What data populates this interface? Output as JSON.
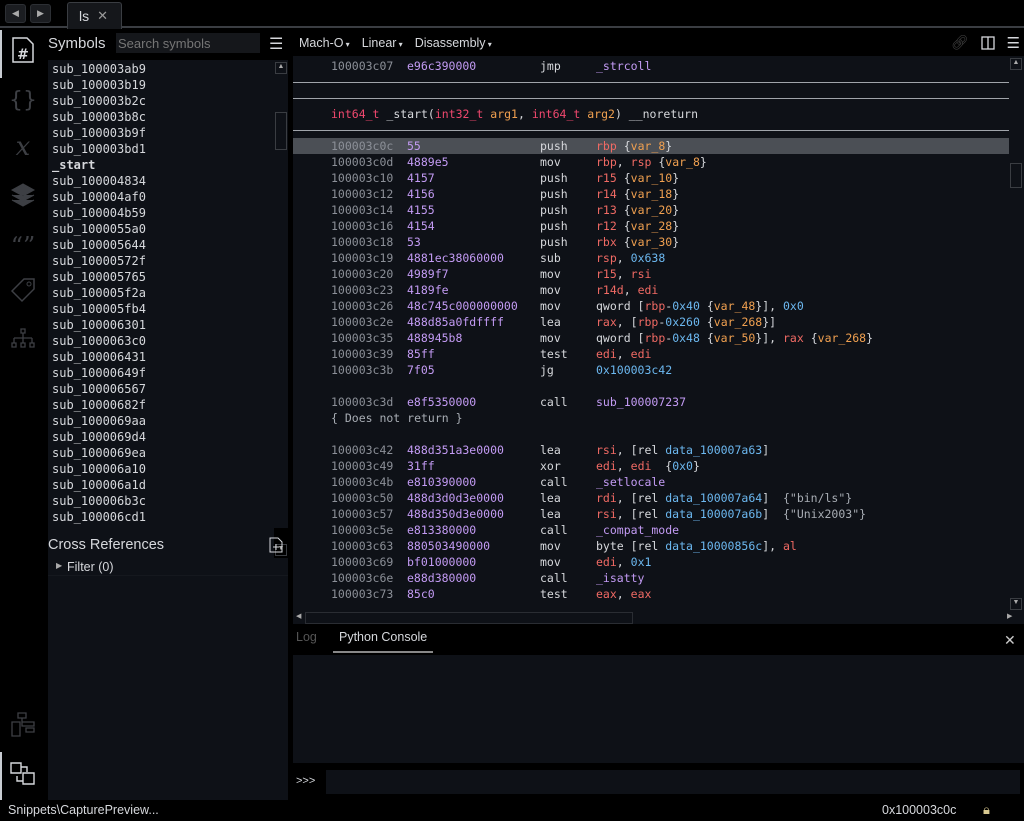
{
  "tabs": {
    "back": "◀",
    "forward": "▶",
    "document": "ls",
    "close": "✕"
  },
  "sidebar_icons": [
    "symbols-icon",
    "types-icon",
    "variables-icon",
    "stack-icon",
    "strings-icon",
    "tags-icon",
    "hierarchy-icon"
  ],
  "symbols": {
    "title": "Symbols",
    "search_placeholder": "Search symbols",
    "items": [
      "sub_100003ab9",
      "sub_100003b19",
      "sub_100003b2c",
      "sub_100003b8c",
      "sub_100003b9f",
      "sub_100003bd1",
      "_start",
      "sub_100004834",
      "sub_100004af0",
      "sub_100004b59",
      "sub_1000055a0",
      "sub_100005644",
      "sub_10000572f",
      "sub_100005765",
      "sub_100005f2a",
      "sub_100005fb4",
      "sub_100006301",
      "sub_1000063c0",
      "sub_100006431",
      "sub_10000649f",
      "sub_100006567",
      "sub_10000682f",
      "sub_1000069aa",
      "sub_1000069d4",
      "sub_1000069ea",
      "sub_100006a10",
      "sub_100006a1d",
      "sub_100006b3c",
      "sub_100006cd1"
    ],
    "selected": "_start"
  },
  "xref": {
    "title": "Cross References",
    "filter": "Filter (0)"
  },
  "toolbar": {
    "view_type": "Mach-O",
    "layout": "Linear",
    "mode": "Disassembly"
  },
  "disassembly": {
    "pre": {
      "addr": "100003c07",
      "bytes": "e96c390000",
      "mn": "jmp",
      "ops": [
        [
          "_strcoll",
          "s"
        ]
      ]
    },
    "func_header": [
      [
        "int64_t",
        "t"
      ],
      [
        " _start(",
        "p"
      ],
      [
        "int32_t",
        "t"
      ],
      [
        " ",
        "p"
      ],
      [
        "arg1",
        "a"
      ],
      [
        ", ",
        "p"
      ],
      [
        "int64_t",
        "t"
      ],
      [
        " ",
        "p"
      ],
      [
        "arg2",
        "a"
      ],
      [
        ") __noreturn",
        "p"
      ]
    ],
    "lines": [
      {
        "addr": "100003c0c",
        "bytes": "55",
        "mn": "push",
        "ops": [
          [
            "rbp",
            "r"
          ],
          [
            " {",
            "p"
          ],
          [
            "var_8",
            "v"
          ],
          [
            "}",
            "p"
          ]
        ],
        "hl": true
      },
      {
        "addr": "100003c0d",
        "bytes": "4889e5",
        "mn": "mov",
        "ops": [
          [
            "rbp",
            "r"
          ],
          [
            ", ",
            "p"
          ],
          [
            "rsp",
            "r"
          ],
          [
            " {",
            "p"
          ],
          [
            "var_8",
            "v"
          ],
          [
            "}",
            "p"
          ]
        ]
      },
      {
        "addr": "100003c10",
        "bytes": "4157",
        "mn": "push",
        "ops": [
          [
            "r15",
            "r"
          ],
          [
            " {",
            "p"
          ],
          [
            "var_10",
            "v"
          ],
          [
            "}",
            "p"
          ]
        ]
      },
      {
        "addr": "100003c12",
        "bytes": "4156",
        "mn": "push",
        "ops": [
          [
            "r14",
            "r"
          ],
          [
            " {",
            "p"
          ],
          [
            "var_18",
            "v"
          ],
          [
            "}",
            "p"
          ]
        ]
      },
      {
        "addr": "100003c14",
        "bytes": "4155",
        "mn": "push",
        "ops": [
          [
            "r13",
            "r"
          ],
          [
            " {",
            "p"
          ],
          [
            "var_20",
            "v"
          ],
          [
            "}",
            "p"
          ]
        ]
      },
      {
        "addr": "100003c16",
        "bytes": "4154",
        "mn": "push",
        "ops": [
          [
            "r12",
            "r"
          ],
          [
            " {",
            "p"
          ],
          [
            "var_28",
            "v"
          ],
          [
            "}",
            "p"
          ]
        ]
      },
      {
        "addr": "100003c18",
        "bytes": "53",
        "mn": "push",
        "ops": [
          [
            "rbx",
            "r"
          ],
          [
            " {",
            "p"
          ],
          [
            "var_30",
            "v"
          ],
          [
            "}",
            "p"
          ]
        ]
      },
      {
        "addr": "100003c19",
        "bytes": "4881ec38060000",
        "mn": "sub",
        "ops": [
          [
            "rsp",
            "r"
          ],
          [
            ", ",
            "p"
          ],
          [
            "0x638",
            "n"
          ]
        ]
      },
      {
        "addr": "100003c20",
        "bytes": "4989f7",
        "mn": "mov",
        "ops": [
          [
            "r15",
            "r"
          ],
          [
            ", ",
            "p"
          ],
          [
            "rsi",
            "r"
          ]
        ]
      },
      {
        "addr": "100003c23",
        "bytes": "4189fe",
        "mn": "mov",
        "ops": [
          [
            "r14d",
            "r"
          ],
          [
            ", ",
            "p"
          ],
          [
            "edi",
            "r"
          ]
        ]
      },
      {
        "addr": "100003c26",
        "bytes": "48c745c000000000",
        "mn": "mov",
        "ops": [
          [
            "qword [",
            "p"
          ],
          [
            "rbp",
            "r"
          ],
          [
            "-",
            "p"
          ],
          [
            "0x40",
            "n"
          ],
          [
            " {",
            "p"
          ],
          [
            "var_48",
            "v"
          ],
          [
            "}], ",
            "p"
          ],
          [
            "0x0",
            "n"
          ]
        ]
      },
      {
        "addr": "100003c2e",
        "bytes": "488d85a0fdffff",
        "mn": "lea",
        "ops": [
          [
            "rax",
            "r"
          ],
          [
            ", [",
            "p"
          ],
          [
            "rbp",
            "r"
          ],
          [
            "-",
            "p"
          ],
          [
            "0x260",
            "n"
          ],
          [
            " {",
            "p"
          ],
          [
            "var_268",
            "v"
          ],
          [
            "}]",
            "p"
          ]
        ]
      },
      {
        "addr": "100003c35",
        "bytes": "488945b8",
        "mn": "mov",
        "ops": [
          [
            "qword [",
            "p"
          ],
          [
            "rbp",
            "r"
          ],
          [
            "-",
            "p"
          ],
          [
            "0x48",
            "n"
          ],
          [
            " {",
            "p"
          ],
          [
            "var_50",
            "v"
          ],
          [
            "}], ",
            "p"
          ],
          [
            "rax",
            "r"
          ],
          [
            " {",
            "p"
          ],
          [
            "var_268",
            "v"
          ],
          [
            "}",
            "p"
          ]
        ]
      },
      {
        "addr": "100003c39",
        "bytes": "85ff",
        "mn": "test",
        "ops": [
          [
            "edi",
            "r"
          ],
          [
            ", ",
            "p"
          ],
          [
            "edi",
            "r"
          ]
        ]
      },
      {
        "addr": "100003c3b",
        "bytes": "7f05",
        "mn": "jg",
        "ops": [
          [
            "0x100003c42",
            "n"
          ]
        ]
      },
      {
        "blank": true
      },
      {
        "addr": "100003c3d",
        "bytes": "e8f5350000",
        "mn": "call",
        "ops": [
          [
            "sub_100007237",
            "s"
          ]
        ]
      },
      {
        "comment": "{ Does not return }"
      },
      {
        "blank": true
      },
      {
        "addr": "100003c42",
        "bytes": "488d351a3e0000",
        "mn": "lea",
        "ops": [
          [
            "rsi",
            "r"
          ],
          [
            ", [rel ",
            "p"
          ],
          [
            "data_100007a63",
            "d"
          ],
          [
            "]",
            "p"
          ]
        ]
      },
      {
        "addr": "100003c49",
        "bytes": "31ff",
        "mn": "xor",
        "ops": [
          [
            "edi",
            "r"
          ],
          [
            ", ",
            "p"
          ],
          [
            "edi",
            "r"
          ],
          [
            "  {",
            "p"
          ],
          [
            "0x0",
            "n"
          ],
          [
            "}",
            "p"
          ]
        ]
      },
      {
        "addr": "100003c4b",
        "bytes": "e810390000",
        "mn": "call",
        "ops": [
          [
            "_setlocale",
            "s"
          ]
        ]
      },
      {
        "addr": "100003c50",
        "bytes": "488d3d0d3e0000",
        "mn": "lea",
        "ops": [
          [
            "rdi",
            "r"
          ],
          [
            ", [rel ",
            "p"
          ],
          [
            "data_100007a64",
            "d"
          ],
          [
            "]  ",
            "p"
          ],
          [
            "{\"bin/ls\"}",
            "c"
          ]
        ]
      },
      {
        "addr": "100003c57",
        "bytes": "488d350d3e0000",
        "mn": "lea",
        "ops": [
          [
            "rsi",
            "r"
          ],
          [
            ", [rel ",
            "p"
          ],
          [
            "data_100007a6b",
            "d"
          ],
          [
            "]  ",
            "p"
          ],
          [
            "{\"Unix2003\"}",
            "c"
          ]
        ]
      },
      {
        "addr": "100003c5e",
        "bytes": "e813380000",
        "mn": "call",
        "ops": [
          [
            "_compat_mode",
            "s"
          ]
        ]
      },
      {
        "addr": "100003c63",
        "bytes": "880503490000",
        "mn": "mov",
        "ops": [
          [
            "byte [rel ",
            "p"
          ],
          [
            "data_10000856c",
            "d"
          ],
          [
            "], ",
            "p"
          ],
          [
            "al",
            "r"
          ]
        ]
      },
      {
        "addr": "100003c69",
        "bytes": "bf01000000",
        "mn": "mov",
        "ops": [
          [
            "edi",
            "r"
          ],
          [
            ", ",
            "p"
          ],
          [
            "0x1",
            "n"
          ]
        ]
      },
      {
        "addr": "100003c6e",
        "bytes": "e88d380000",
        "mn": "call",
        "ops": [
          [
            "_isatty",
            "s"
          ]
        ]
      },
      {
        "addr": "100003c73",
        "bytes": "85c0",
        "mn": "test",
        "ops": [
          [
            "eax",
            "r"
          ],
          [
            ", ",
            "p"
          ],
          [
            "eax",
            "r"
          ]
        ]
      }
    ]
  },
  "bottom": {
    "tabs": [
      "Log",
      "Python Console"
    ],
    "active_tab": "Python Console",
    "prompt": ">>>",
    "close": "✕"
  },
  "status": {
    "left": "Snippets\\CapturePreview...",
    "address": "0x100003c0c"
  },
  "colors": {
    "register": "#f06a64",
    "variable": "#f0a050",
    "number": "#6cb8f0",
    "symbol": "#c39bf4",
    "type": "#f0486e",
    "highlight": "#4b4f55",
    "panel_bg": "#0e1117"
  }
}
